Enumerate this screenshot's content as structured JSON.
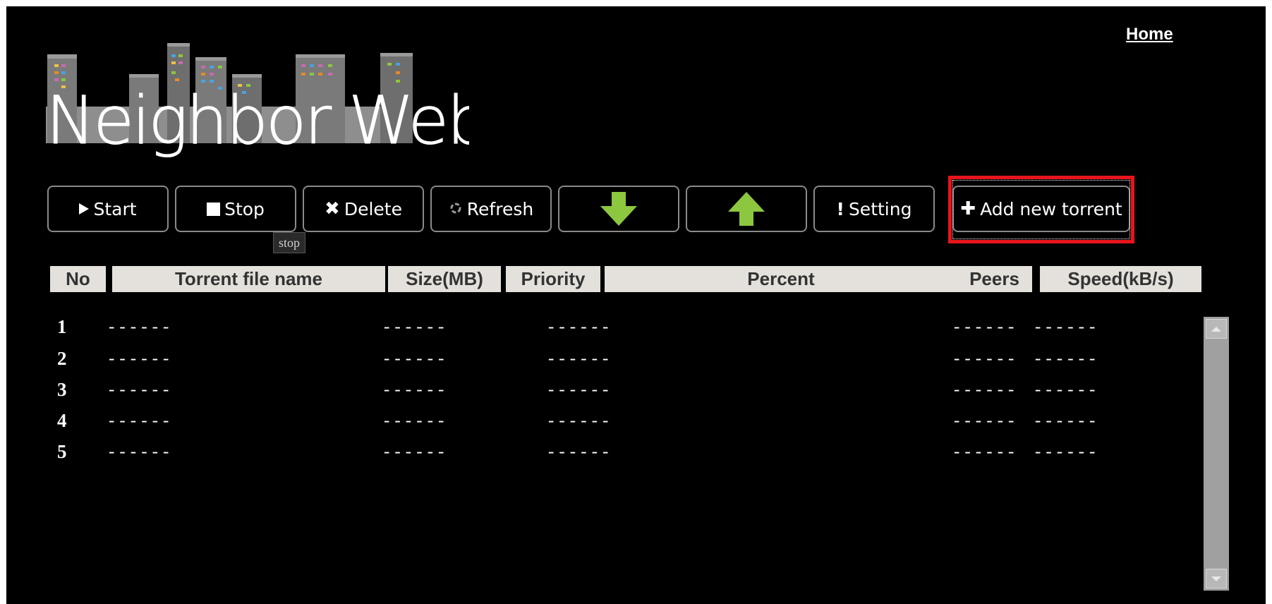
{
  "header": {
    "home_link": "Home",
    "logo_text": "Neighbor Web"
  },
  "toolbar": {
    "start_label": "Start",
    "stop_label": "Stop",
    "delete_label": "Delete",
    "refresh_label": "Refresh",
    "setting_label": "Setting",
    "add_label": "Add new torrent",
    "tooltip": "stop",
    "icons": [
      "play-icon",
      "stop-icon",
      "delete-icon",
      "refresh-icon",
      "arrow-down-icon",
      "arrow-up-icon",
      "exclamation-icon",
      "plus-icon"
    ]
  },
  "table": {
    "columns": [
      "No",
      "Torrent file name",
      "Size(MB)",
      "Priority",
      "Percent",
      "Peers",
      "Speed(kB/s)"
    ],
    "rows": [
      {
        "no": "1",
        "name": "------",
        "size": "------",
        "priority": "------",
        "peers": "------",
        "speed": "------"
      },
      {
        "no": "2",
        "name": "------",
        "size": "------",
        "priority": "------",
        "peers": "------",
        "speed": "------"
      },
      {
        "no": "3",
        "name": "------",
        "size": "------",
        "priority": "------",
        "peers": "------",
        "speed": "------"
      },
      {
        "no": "4",
        "name": "------",
        "size": "------",
        "priority": "------",
        "peers": "------",
        "speed": "------"
      },
      {
        "no": "5",
        "name": "------",
        "size": "------",
        "priority": "------",
        "peers": "------",
        "speed": "------"
      }
    ]
  },
  "colors": {
    "background": "#000000",
    "header_bg": "#e4e1dc",
    "arrow_green": "#8dc63f",
    "highlight_red": "#e8141c"
  }
}
